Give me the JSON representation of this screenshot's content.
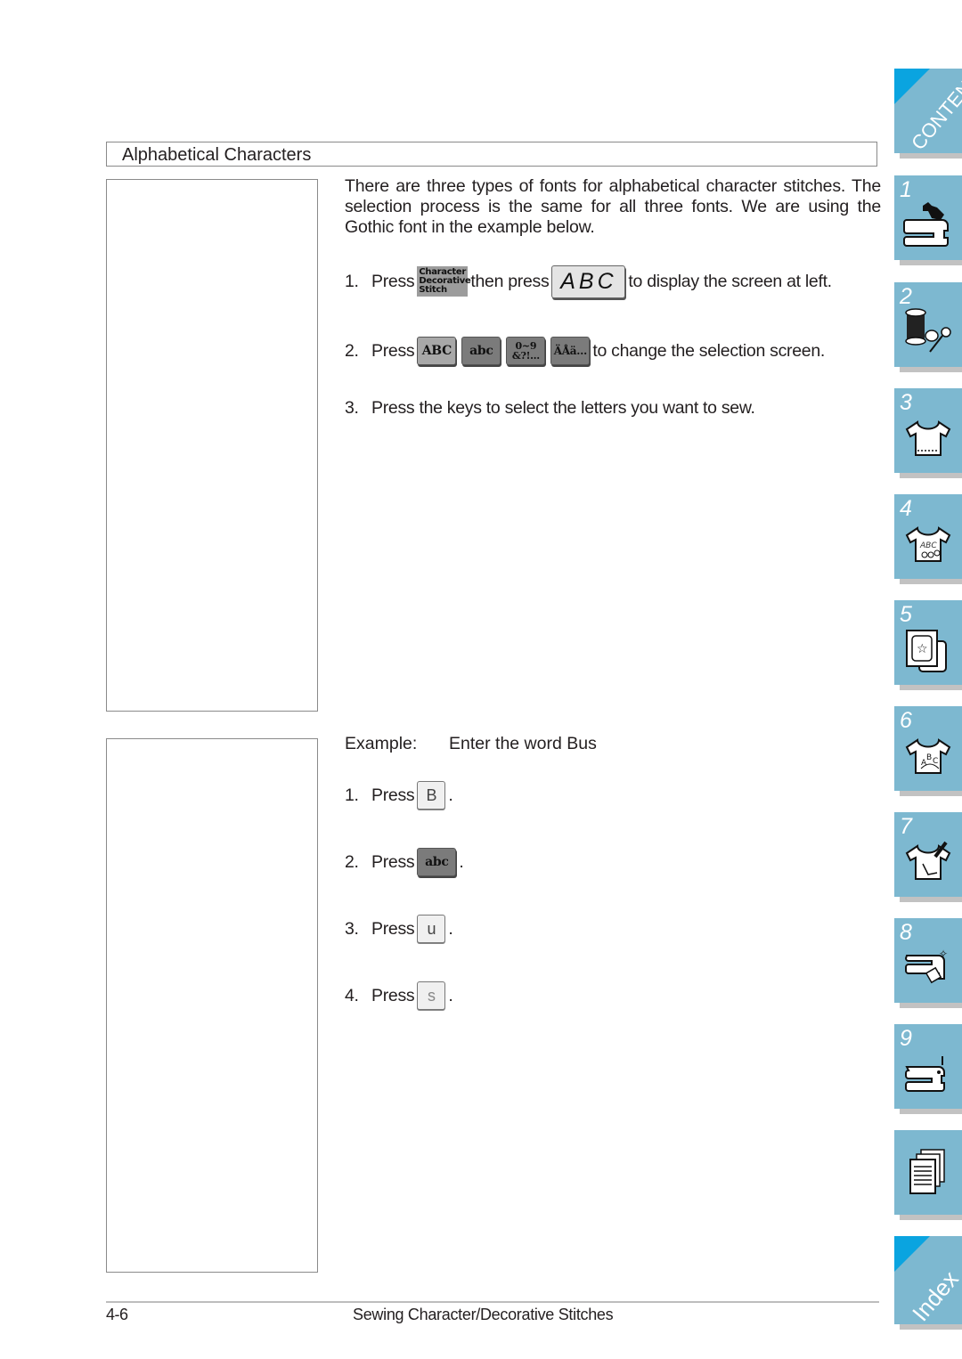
{
  "section": {
    "title": "Alphabetical Characters"
  },
  "intro": "There are three types of fonts for alphabetical character stitches. The selection process is the same for all three fonts. We are using the Gothic font in the example below.",
  "steps": [
    {
      "num": "1.",
      "press": "Press",
      "key1_lines": [
        "Character",
        "Decorative",
        "Stitch"
      ],
      "then": "then press",
      "key2": "ABC",
      "tail": "to display the screen at left."
    },
    {
      "num": "2.",
      "press": "Press",
      "keys": [
        "ABC",
        "abc",
        "0~9",
        "&?!…",
        "ÄÅä…"
      ],
      "tail": "to change the selection screen."
    },
    {
      "num": "3.",
      "text": "Press the keys to select the letters you want to sew."
    }
  ],
  "example": {
    "label": "Example:",
    "text": "Enter the word  Bus",
    "steps": [
      {
        "num": "1.",
        "press": "Press",
        "key": "B",
        "tail": "."
      },
      {
        "num": "2.",
        "press": "Press",
        "key": "abc",
        "tail": "."
      },
      {
        "num": "3.",
        "press": "Press",
        "key": "u",
        "tail": "."
      },
      {
        "num": "4.",
        "press": "Press",
        "key": "s",
        "tail": "."
      }
    ]
  },
  "footer": {
    "page": "4-6",
    "chapter": "Sewing Character/Decorative Stitches"
  },
  "side_tabs": [
    {
      "label": "CONTENTS",
      "icon": "contents"
    },
    {
      "label": "1",
      "icon": "sewing-machine-hand-icon"
    },
    {
      "label": "2",
      "icon": "thread-spool-scissors-icon"
    },
    {
      "label": "3",
      "icon": "shirt-stitch-icon"
    },
    {
      "label": "4",
      "icon": "shirt-embroidery-icon"
    },
    {
      "label": "5",
      "icon": "embroidery-frame-icon"
    },
    {
      "label": "6",
      "icon": "shirt-letters-icon"
    },
    {
      "label": "7",
      "icon": "shirt-pen-icon"
    },
    {
      "label": "8",
      "icon": "machine-maintenance-icon"
    },
    {
      "label": "9",
      "icon": "sewing-machine-needle-icon"
    },
    {
      "label": "",
      "icon": "documents-icon"
    },
    {
      "label": "Index",
      "icon": "index"
    }
  ],
  "colors": {
    "tab_bg": "#7db8d0",
    "tab_corner": "#0aa4e0",
    "tab_shadow": "#c2c2c2"
  }
}
